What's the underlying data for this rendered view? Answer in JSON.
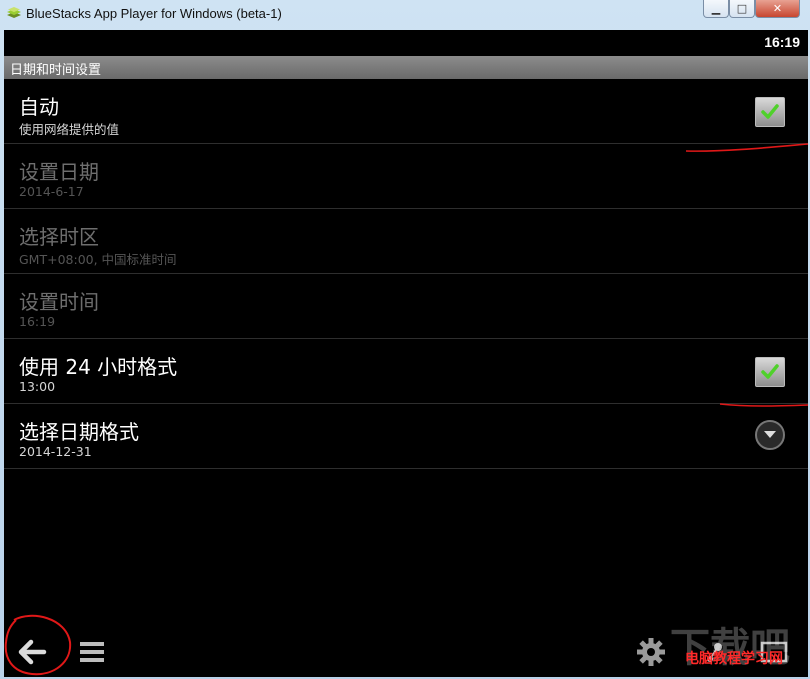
{
  "window": {
    "title": "BlueStacks App Player for Windows (beta-1)"
  },
  "status_bar": {
    "clock": "16:19"
  },
  "settings": {
    "header": "日期和时间设置",
    "items": [
      {
        "title": "自动",
        "summary": "使用网络提供的值",
        "control": "checkbox",
        "checked": true,
        "enabled": true
      },
      {
        "title": "设置日期",
        "summary": "2014-6-17",
        "control": "none",
        "enabled": false
      },
      {
        "title": "选择时区",
        "summary": "GMT+08:00, 中国标准时间",
        "control": "none",
        "enabled": false
      },
      {
        "title": "设置时间",
        "summary": "16:19",
        "control": "none",
        "enabled": false
      },
      {
        "title": "使用 24 小时格式",
        "summary": "13:00",
        "control": "checkbox",
        "checked": true,
        "enabled": true
      },
      {
        "title": "选择日期格式",
        "summary": "2014-12-31",
        "control": "dropdown",
        "enabled": true
      }
    ]
  },
  "navbar": {
    "icons": [
      "back-arrow-icon",
      "menu-icon",
      "gear-icon",
      "share-icon",
      "fullscreen-icon"
    ]
  },
  "watermark": {
    "logo_text": "下载吧",
    "site_text": "电脑教程学习网",
    "color": "#ff2a2a"
  },
  "colors": {
    "accent_check": "#4fd12a",
    "annotation_red": "#e01818",
    "header_bg": "#7d7d7d"
  }
}
